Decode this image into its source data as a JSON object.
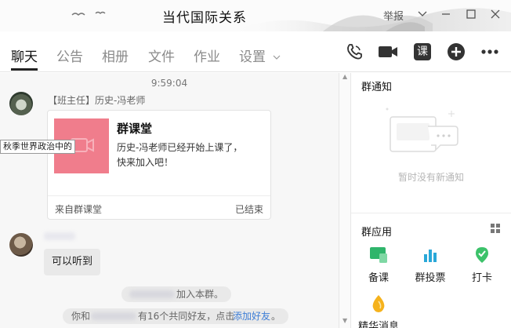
{
  "window": {
    "title": "当代国际关系",
    "report_label": "举报"
  },
  "tabs": [
    {
      "label": "聊天",
      "active": true
    },
    {
      "label": "公告",
      "active": false
    },
    {
      "label": "相册",
      "active": false
    },
    {
      "label": "文件",
      "active": false
    },
    {
      "label": "作业",
      "active": false
    },
    {
      "label": "设置",
      "active": false
    }
  ],
  "toolbar": {
    "class_button_label": "课",
    "icons": [
      "phone-icon",
      "video-call-icon",
      "class-icon",
      "add-icon",
      "more-icon"
    ]
  },
  "chat": {
    "timestamp": "9:59:04",
    "tooltip_text": "秋季世界政治中的",
    "message1": {
      "sender": "【班主任】历史-冯老师",
      "card": {
        "title": "群课堂",
        "description": "历史-冯老师已经开始上课了，快来加入吧！",
        "source": "来自群课堂",
        "status": "已结束"
      }
    },
    "message2": {
      "text": "可以听到"
    },
    "system": {
      "join_text": "加入本群。",
      "friends_prefix": "你和",
      "friends_middle": "有16个共同好友，点击",
      "friends_link": "添加好友",
      "friends_suffix": "。"
    }
  },
  "right_panel": {
    "notice_title": "群通知",
    "notice_empty": "暂时没有新通知",
    "apps_title": "群应用",
    "apps": [
      {
        "label": "备课",
        "icon": "prepare-lesson-icon",
        "color": "#2fb56b"
      },
      {
        "label": "群投票",
        "icon": "vote-icon",
        "color": "#2aa8d8"
      },
      {
        "label": "打卡",
        "icon": "checkin-icon",
        "color": "#3cc26a"
      },
      {
        "label": "精华消息",
        "icon": "highlight-icon",
        "color": "#f5b21c"
      }
    ]
  },
  "colors": {
    "card_image": "#f07d8c",
    "link": "#3d7dd6"
  }
}
